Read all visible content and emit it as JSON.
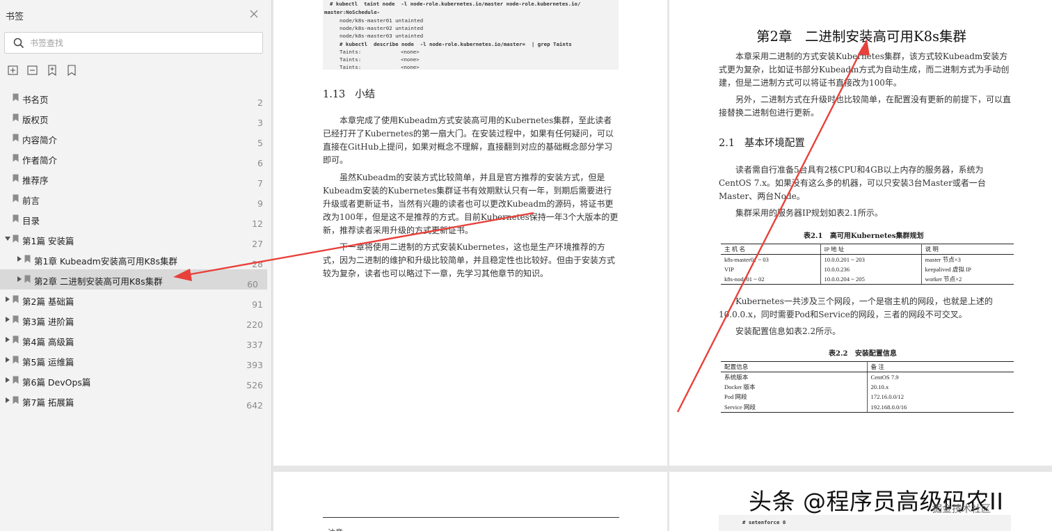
{
  "sidebar": {
    "title": "书签",
    "search_placeholder": "书签查找",
    "bookmarks": [
      {
        "label": "书名页",
        "page": "2"
      },
      {
        "label": "版权页",
        "page": "3"
      },
      {
        "label": "内容简介",
        "page": "5"
      },
      {
        "label": "作者简介",
        "page": "6"
      },
      {
        "label": "推荐序",
        "page": "7"
      },
      {
        "label": "前言",
        "page": "9"
      },
      {
        "label": "目录",
        "page": "12"
      },
      {
        "label": "第1篇 安装篇",
        "page": "27"
      },
      {
        "label": "第1章 Kubeadm安装高可用K8s集群",
        "page": "28"
      },
      {
        "label": "第2章 二进制安装高可用K8s集群",
        "page": "60"
      },
      {
        "label": "第2篇 基础篇",
        "page": "91"
      },
      {
        "label": "第3篇 进阶篇",
        "page": "220"
      },
      {
        "label": "第4篇 高级篇",
        "page": "337"
      },
      {
        "label": "第5篇 运维篇",
        "page": "393"
      },
      {
        "label": "第6篇 DevOps篇",
        "page": "526"
      },
      {
        "label": "第7篇 拓展篇",
        "page": "642"
      }
    ]
  },
  "page_left": {
    "code_lines": [
      "# kubectl  taint node  -l node-role.kubernetes.io/master node-role.kubernetes.io/",
      "master:NoSchedule-",
      "node/k8s-master01 untainted",
      "node/k8s-master02 untainted",
      "node/k8s-master03 untainted",
      "# kubectl  describe node  -l node-role.kubernetes.io/master=  | grep Taints",
      "Taints:",
      "Taints:",
      "Taints:",
      "<none>",
      "<none>",
      "<none>"
    ],
    "section_title": "1.13   小结",
    "paragraphs": [
      "本章完成了使用Kubeadm方式安装高可用的Kubernetes集群，至此读者已经打开了Kubernetes的第一扇大门。在安装过程中，如果有任何疑问，可以直接在GitHub上提问，如果对概念不理解，直接翻到对应的基础概念部分学习即可。",
      "虽然Kubeadm的安装方式比较简单，并且是官方推荐的安装方式，但是Kubeadm安装的Kubernetes集群证书有效期默认只有一年，到期后需要进行升级或者更新证书，当然有兴趣的读者也可以更改Kubeadm的源码，将证书更改为100年，但是这不是推荐的方式。目前Kubernetes保持一年3个大版本的更新，推荐读者采用升级的方式更新证书。",
      "下一章将使用二进制的方式安装Kubernetes，这也是生产环境推荐的方式，因为二进制的维护和升级比较简单，并且稳定性也比较好。但由于安装方式较为复杂，读者也可以略过下一章，先学习其他章节的知识。"
    ]
  },
  "page_right": {
    "chapter_title": "第2章   二进制安装高可用K8s集群",
    "intro_paragraphs": [
      "本章采用二进制的方式安装Kubernetes集群，该方式较Kubeadm安装方式更为复杂，比如证书部分Kubeadm方式为自动生成，而二进制方式为手动创建，但是二进制方式可以将证书直接改为100年。",
      "另外，二进制方式在升级时也比较简单，在配置没有更新的前提下，可以直接替换二进制包进行更新。"
    ],
    "section_title": "2.1   基本环境配置",
    "env_paragraphs": [
      "读者需自行准备5台具有2核CPU和4GB以上内存的服务器，系统为CentOS 7.x。如果没有这么多的机器，可以只安装3台Master或者一台Master、两台Node。",
      "集群采用的服务器IP规划如表2.1所示。"
    ],
    "table1": {
      "caption": "表2.1   高可用Kubernetes集群规划",
      "headers": [
        "主 机 名",
        "IP 地 址",
        "说   明"
      ],
      "rows": [
        [
          "k8s-master01 ~ 03",
          "10.0.0.201 ~ 203",
          "master 节点×3"
        ],
        [
          "VIP",
          "10.0.0.236",
          "keepalived 虚拟 IP"
        ],
        [
          "k8s-node01 ~ 02",
          "10.0.0.204 ~ 205",
          "worker 节点×2"
        ]
      ]
    },
    "net_paragraphs": [
      "Kubernetes一共涉及三个网段，一个是宿主机的网段，也就是上述的10.0.0.x，同时需要Pod和Service的网段，三者的网段不可交叉。",
      "安装配置信息如表2.2所示。"
    ],
    "table2": {
      "caption": "表2.2   安装配置信息",
      "headers": [
        "配置信息",
        "备   注"
      ],
      "rows": [
        [
          "系统版本",
          "CentOS 7.9"
        ],
        [
          "Docker 版本",
          "20.10.x"
        ],
        [
          "Pod 网段",
          "172.16.0.0/12"
        ],
        [
          "Service 网段",
          "192.168.0.0/16"
        ]
      ]
    }
  },
  "page_bottom": {
    "left_partial": "注意",
    "right_code": "# setenforce 0"
  },
  "watermark": {
    "main": "头条 @程序员高级码农II",
    "sub": "掘金技术社区"
  },
  "colors": {
    "arrow": "#e8403a",
    "selected_row": "#d9d9d9",
    "sidebar_bg": "#f3f3f3"
  }
}
